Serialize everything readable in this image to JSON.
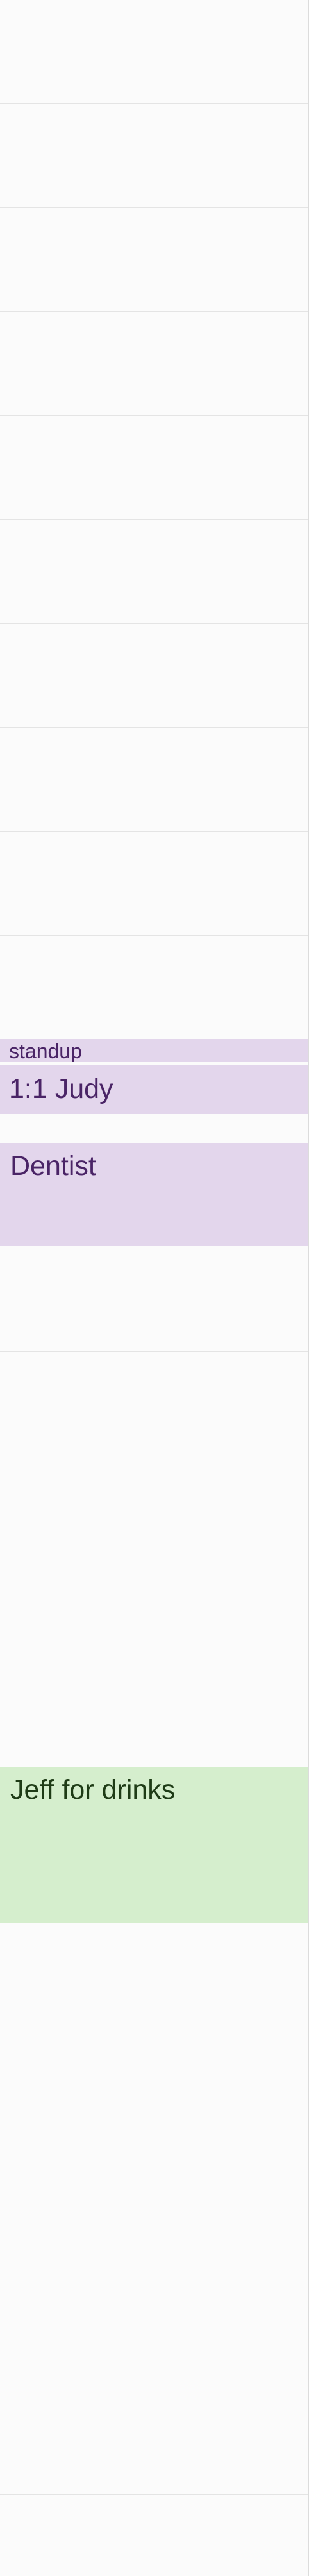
{
  "colors": {
    "background": "#fbfbfb",
    "gridline": "#e4e4e4",
    "purple_event_bg": "#e3d6ec",
    "purple_event_text": "#4a2466",
    "green_event_bg": "#d5eecd",
    "green_event_text": "#1e3b16"
  },
  "events": [
    {
      "title": "standup",
      "color": "purple"
    },
    {
      "title": "1:1 Judy",
      "color": "purple"
    },
    {
      "title": "Dentist",
      "color": "purple"
    },
    {
      "title": "Jeff for drinks",
      "color": "green"
    }
  ]
}
